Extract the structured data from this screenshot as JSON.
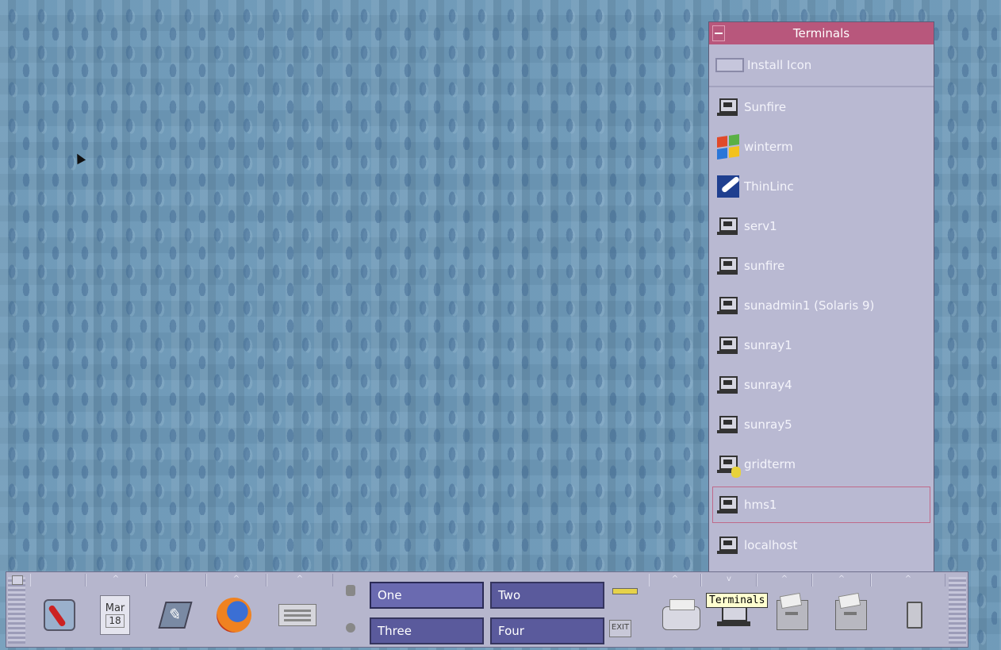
{
  "subpanel": {
    "title": "Terminals",
    "install_label": "Install Icon",
    "items": [
      {
        "label": "Sunfire",
        "icon": "terminal-icon"
      },
      {
        "label": "winterm",
        "icon": "windows-icon"
      },
      {
        "label": "ThinLinc",
        "icon": "thinlinc-icon"
      },
      {
        "label": "serv1",
        "icon": "terminal-icon"
      },
      {
        "label": "sunfire",
        "icon": "terminal-icon"
      },
      {
        "label": "sunadmin1 (Solaris 9)",
        "icon": "terminal-icon"
      },
      {
        "label": "sunray1",
        "icon": "terminal-icon"
      },
      {
        "label": "sunray4",
        "icon": "terminal-icon"
      },
      {
        "label": "sunray5",
        "icon": "terminal-icon"
      },
      {
        "label": "gridterm",
        "icon": "grid-terminal-icon"
      },
      {
        "label": "hms1",
        "icon": "terminal-icon",
        "selected": true
      },
      {
        "label": "localhost",
        "icon": "terminal-icon"
      }
    ]
  },
  "panel": {
    "calendar": {
      "month": "Mar",
      "day": "18"
    },
    "workspaces": [
      "One",
      "Two",
      "Three",
      "Four"
    ],
    "active_workspace": "One",
    "exit_label": "EXIT"
  },
  "tooltip": "Terminals"
}
